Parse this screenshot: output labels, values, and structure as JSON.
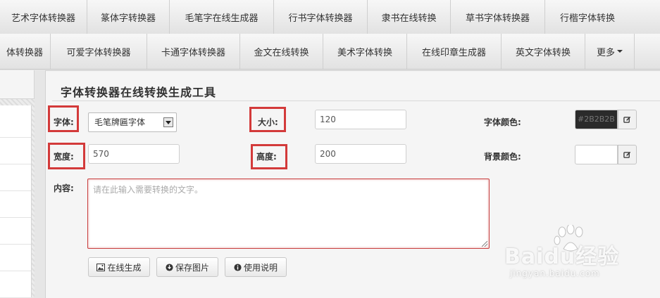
{
  "nav_row1": [
    "艺术字体转换器",
    "篆体字转换器",
    "毛笔字在线生成器",
    "行书字体转换器",
    "隶书在线转换",
    "草书字体转换器",
    "行楷字体转换"
  ],
  "nav_row2": [
    "体转换器",
    "可爱字体转换器",
    "卡通字体转换器",
    "金文在线转换",
    "美术字体转换",
    "在线印章生成器",
    "英文字体转换",
    "更多"
  ],
  "panel_title": "字体转换器在线转换生成工具",
  "form": {
    "font_label": "字体:",
    "font_value": "毛笔牌匾字体",
    "size_label": "大小:",
    "size_value": "120",
    "font_color_label": "字体颜色:",
    "font_color_value": "#2B2B2B",
    "width_label": "宽度:",
    "width_value": "570",
    "height_label": "高度:",
    "height_value": "200",
    "bg_color_label": "背景颜色:",
    "bg_color_value": "",
    "content_label": "内容:",
    "content_placeholder": "请在此输入需要转换的文字。"
  },
  "buttons": {
    "generate": "在线生成",
    "save": "保存图片",
    "help": "使用说明"
  },
  "watermark": {
    "brand": "Baidu经验",
    "url": "jingyan.baidu.com"
  },
  "colors": {
    "highlight": "#d33a3a",
    "font_color_swatch": "#2B2B2B"
  }
}
